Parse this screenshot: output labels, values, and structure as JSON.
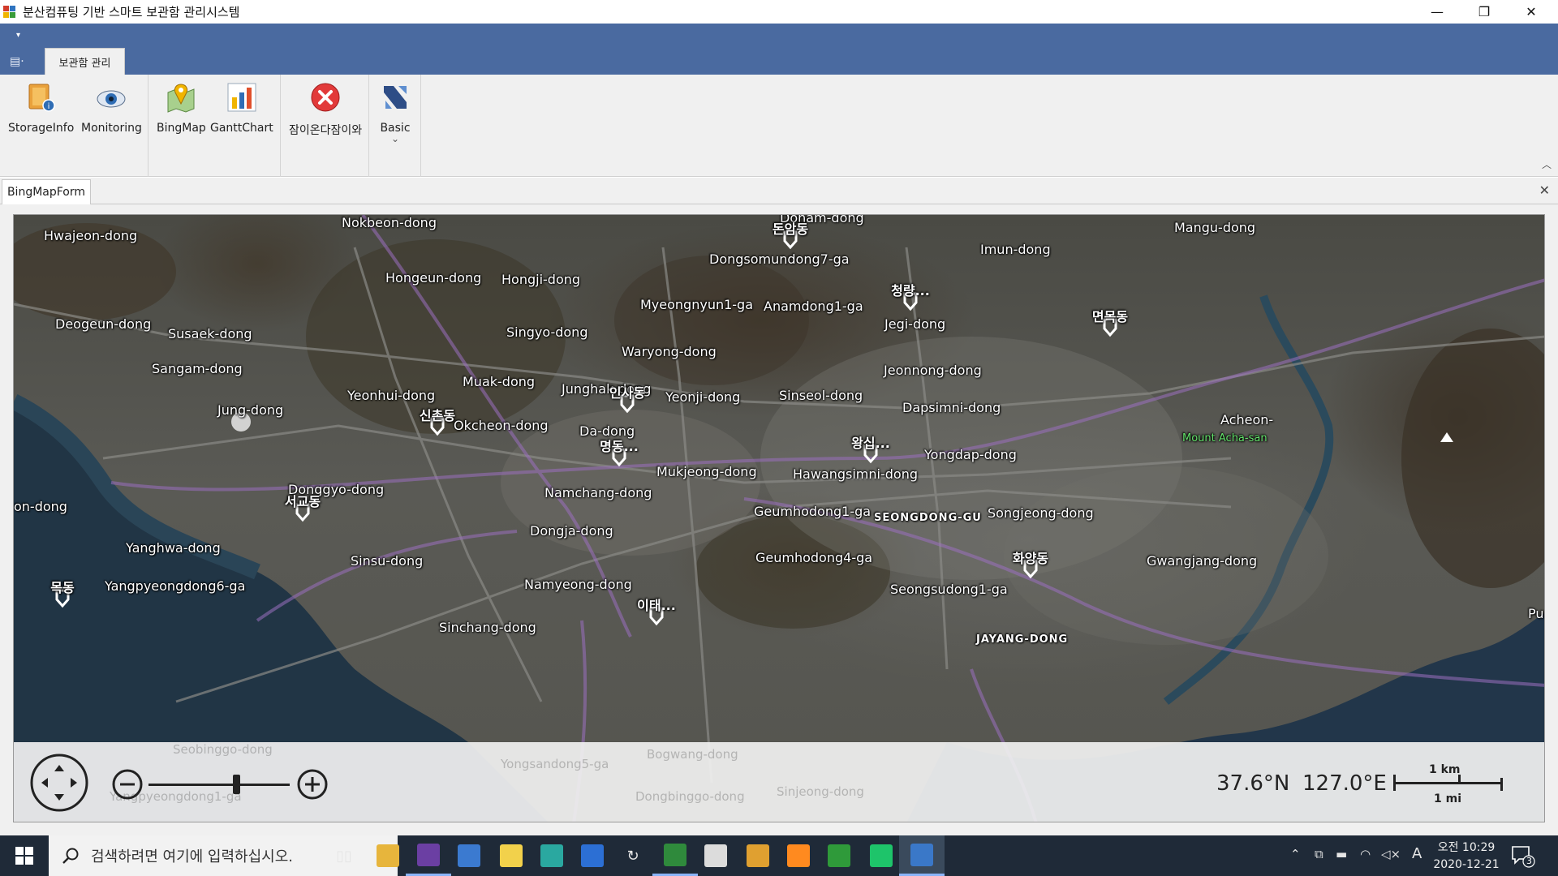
{
  "window": {
    "title": "분산컴퓨팅 기반 스마트 보관함 관리시스템",
    "minimize": "—",
    "restore": "❐",
    "close": "✕"
  },
  "ribbon": {
    "qat_dropdown": "▾",
    "app_menu": "▤·",
    "tab_label": "보관함 관리",
    "buttons": [
      {
        "label": "StorageInfo",
        "icon": "storage-info-icon"
      },
      {
        "label": "Monitoring",
        "icon": "eye-icon"
      },
      {
        "label": "BingMap",
        "icon": "map-pin-icon"
      },
      {
        "label": "GanttChart",
        "icon": "gantt-chart-icon"
      },
      {
        "label": "잠이온다잠이와",
        "icon": "red-x-icon"
      },
      {
        "label": "Basic",
        "icon": "skin-gallery-icon",
        "dropdown": "⌄"
      }
    ],
    "collapse_glyph": "︿"
  },
  "document": {
    "tab_label": "BingMapForm",
    "close_glyph": "✕"
  },
  "map": {
    "place_labels": [
      {
        "text": "Nokbeon-dong",
        "style": "normal"
      },
      {
        "text": "Hwajeon-dong",
        "style": "normal"
      },
      {
        "text": "Hongeun-dong",
        "style": "normal"
      },
      {
        "text": "Hongji-dong",
        "style": "normal"
      },
      {
        "text": "Donam-dong",
        "style": "normal"
      },
      {
        "text": "Dongsomundong7-ga",
        "style": "normal"
      },
      {
        "text": "Imun-dong",
        "style": "normal"
      },
      {
        "text": "Mangu-dong",
        "style": "normal"
      },
      {
        "text": "Myeongnyun1-ga",
        "style": "normal"
      },
      {
        "text": "Anamdong1-ga",
        "style": "normal"
      },
      {
        "text": "Deogeun-dong",
        "style": "normal"
      },
      {
        "text": "Susaek-dong",
        "style": "normal"
      },
      {
        "text": "Jegi-dong",
        "style": "normal"
      },
      {
        "text": "Singyo-dong",
        "style": "normal"
      },
      {
        "text": "Waryong-dong",
        "style": "normal"
      },
      {
        "text": "Sangam-dong",
        "style": "normal"
      },
      {
        "text": "Jeonnong-dong",
        "style": "normal"
      },
      {
        "text": "Muak-dong",
        "style": "normal"
      },
      {
        "text": "Yeonhui-dong",
        "style": "normal"
      },
      {
        "text": "Junghak-dong",
        "style": "normal"
      },
      {
        "text": "Yeonji-dong",
        "style": "normal"
      },
      {
        "text": "Sinseol-dong",
        "style": "normal"
      },
      {
        "text": "Jung-dong",
        "style": "normal"
      },
      {
        "text": "Dapsimni-dong",
        "style": "normal"
      },
      {
        "text": "Okcheon-dong",
        "style": "normal"
      },
      {
        "text": "Acheon-",
        "style": "normal"
      },
      {
        "text": "Da-dong",
        "style": "normal"
      },
      {
        "text": "Mount Acha-san",
        "style": "green"
      },
      {
        "text": "Yongdap-dong",
        "style": "normal"
      },
      {
        "text": "Mukjeong-dong",
        "style": "normal"
      },
      {
        "text": "Hawangsimni-dong",
        "style": "normal"
      },
      {
        "text": "Donggyo-dong",
        "style": "normal"
      },
      {
        "text": "Namchang-dong",
        "style": "normal"
      },
      {
        "text": "on-dong",
        "style": "normal"
      },
      {
        "text": "Geumhodong1-ga",
        "style": "normal"
      },
      {
        "text": "Songjeong-dong",
        "style": "normal"
      },
      {
        "text": "SEONGDONG-GU",
        "style": "small"
      },
      {
        "text": "Dongja-dong",
        "style": "normal"
      },
      {
        "text": "Yanghwa-dong",
        "style": "normal"
      },
      {
        "text": "Sinsu-dong",
        "style": "normal"
      },
      {
        "text": "Geumhodong4-ga",
        "style": "normal"
      },
      {
        "text": "Gwangjang-dong",
        "style": "normal"
      },
      {
        "text": "Yangpyeongdong6-ga",
        "style": "normal"
      },
      {
        "text": "Namyeong-dong",
        "style": "normal"
      },
      {
        "text": "Seongsudong1-ga",
        "style": "normal"
      },
      {
        "text": "Pun",
        "style": "normal"
      },
      {
        "text": "Sinchang-dong",
        "style": "normal"
      },
      {
        "text": "JAYANG-DONG",
        "style": "small"
      }
    ],
    "pins": [
      {
        "text": "돈암동"
      },
      {
        "text": "청량..."
      },
      {
        "text": "면목동"
      },
      {
        "text": "인사동"
      },
      {
        "text": "신촌동"
      },
      {
        "text": "명동..."
      },
      {
        "text": "왕십..."
      },
      {
        "text": "서교동"
      },
      {
        "text": "화양동"
      },
      {
        "text": "목동"
      },
      {
        "text": "이태..."
      }
    ],
    "ghost_labels": [
      "Yongsandong5-ga",
      "Bogwang-dong",
      "Yangpyeongdong1-ga",
      "Dongbinggo-dong",
      "Seobinggo-dong",
      "Sinjeong-dong"
    ],
    "latitude": "37.6°N",
    "longitude": "127.0°E",
    "scale_km": "1 km",
    "scale_mi": "1 mi"
  },
  "taskbar": {
    "search_placeholder": "검색하려면 여기에 입력하십시오.",
    "apps": [
      {
        "name": "task-view",
        "active": false
      },
      {
        "name": "file-explorer",
        "active": false
      },
      {
        "name": "visual-studio",
        "active": true
      },
      {
        "name": "network-app",
        "active": false
      },
      {
        "name": "sticky-notes",
        "active": false
      },
      {
        "name": "browser",
        "active": false
      },
      {
        "name": "vc-app",
        "active": false
      },
      {
        "name": "sync-app",
        "active": false
      },
      {
        "name": "excel-app",
        "active": true
      },
      {
        "name": "photo-app",
        "active": false
      },
      {
        "name": "paint-app",
        "active": false
      },
      {
        "name": "sublime-app",
        "active": false
      },
      {
        "name": "plug-app",
        "active": false
      },
      {
        "name": "pycharm",
        "active": false
      },
      {
        "name": "storage-manager",
        "active": true
      }
    ],
    "tray_ime": "A",
    "clock_time": "오전 10:29",
    "clock_date": "2020-12-21",
    "notification_count": "3"
  },
  "colors": {
    "ribbon_header": "#4a6aa0",
    "ribbon_body": "#f0f0f0",
    "taskbar": "#1f2a38",
    "map_pin": "#ffffff",
    "road_purple": "#9b6fbf"
  }
}
